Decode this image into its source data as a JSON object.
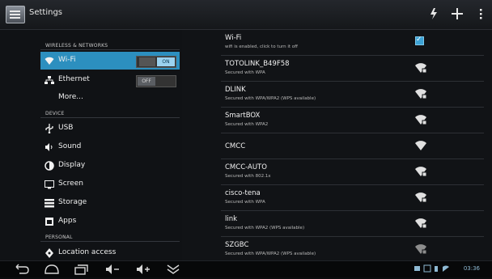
{
  "window": {
    "title": "Settings"
  },
  "toolbar": {
    "actions": [
      "refresh-icon",
      "add-icon",
      "overflow-menu-icon"
    ]
  },
  "sidebar": {
    "section_wireless": "WIRELESS & NETWORKS",
    "section_device": "DEVICE",
    "section_personal": "PERSONAL",
    "items": [
      {
        "label": "Wi-Fi",
        "icon": "wifi-icon",
        "toggle": "ON",
        "selected": true
      },
      {
        "label": "Ethernet",
        "icon": "ethernet-icon",
        "toggle": "OFF",
        "selected": false
      },
      {
        "label": "More...",
        "icon": "",
        "selected": false
      },
      {
        "label": "USB",
        "icon": "usb-icon",
        "selected": false
      },
      {
        "label": "Sound",
        "icon": "speaker-icon",
        "selected": false
      },
      {
        "label": "Display",
        "icon": "brightness-icon",
        "selected": false
      },
      {
        "label": "Screen",
        "icon": "screen-icon",
        "selected": false
      },
      {
        "label": "Storage",
        "icon": "storage-icon",
        "selected": false
      },
      {
        "label": "Apps",
        "icon": "apps-icon",
        "selected": false
      },
      {
        "label": "Location access",
        "icon": "location-icon",
        "selected": false
      }
    ]
  },
  "wifi_panel": {
    "header": {
      "title": "Wi-Fi",
      "subtitle": "wifi is enabled, click to turn it off"
    },
    "networks": [
      {
        "name": "TOTOLINK_B49F58",
        "security": "Secured with WPA"
      },
      {
        "name": "DLINK",
        "security": "Secured with WPA/WPA2 (WPS available)"
      },
      {
        "name": "SmartBOX",
        "security": "Secured with WPA2"
      },
      {
        "name": "CMCC",
        "security": ""
      },
      {
        "name": "CMCC-AUTO",
        "security": "Secured with 802.1x"
      },
      {
        "name": "cisco-tena",
        "security": "Secured with WPA"
      },
      {
        "name": "link",
        "security": "Secured with WPA2 (WPS available)"
      },
      {
        "name": "SZGBC",
        "security": "Secured with WPA/WPA2 (WPS available)"
      }
    ]
  },
  "navbar": {
    "buttons": [
      "back-icon",
      "home-icon",
      "recent-apps-icon",
      "volume-down-icon",
      "volume-up-icon",
      "collapse-icon"
    ],
    "time": "03:36"
  },
  "colors": {
    "accent": "#2c8fbf",
    "background": "#111316"
  }
}
